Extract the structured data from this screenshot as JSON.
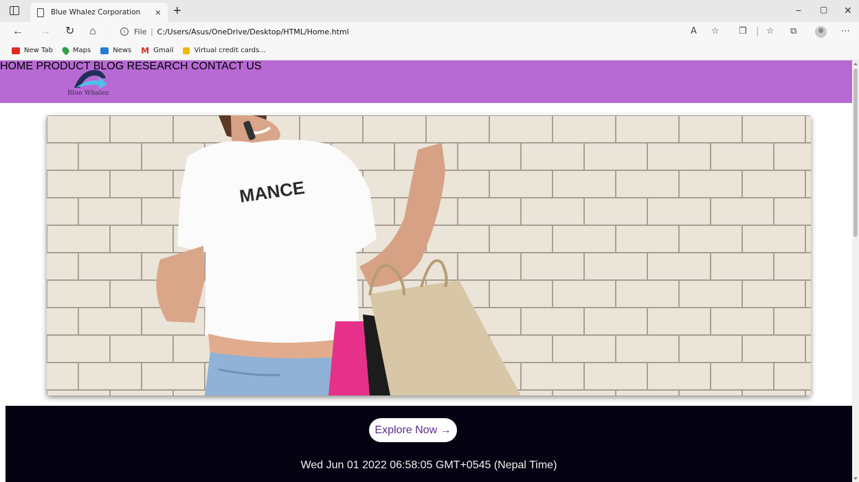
{
  "browser": {
    "tab_title": "Blue Whalez Corporation",
    "address_scheme": "File",
    "address_url": "C:/Users/Asus/OneDrive/Desktop/HTML/Home.html",
    "bookmarks": [
      {
        "label": "New Tab",
        "icon": "youtube-icon",
        "color": "#e02b20"
      },
      {
        "label": "Maps",
        "icon": "maps-pin-icon",
        "color": "#2f9e44"
      },
      {
        "label": "News",
        "icon": "news-icon",
        "color": "#2b7bd6"
      },
      {
        "label": "Gmail",
        "icon": "gmail-icon",
        "color": "#d93025"
      },
      {
        "label": "Virtual credit cards...",
        "icon": "card-icon",
        "color": "#f2b705"
      }
    ]
  },
  "site": {
    "brand_color": "#b76ad3",
    "logo_text": "Blue Whalez",
    "nav": [
      {
        "label": "HOME"
      },
      {
        "label": "PRODUCT"
      },
      {
        "label": "BLOG"
      },
      {
        "label": "RESEARCH"
      },
      {
        "label": "CONTACT US"
      }
    ],
    "hero_image": {
      "subject": "woman-with-shopping-bags",
      "shirt_text": "MANCE"
    },
    "cta_label": "Explore Now →",
    "datetime": "Wed Jun 01 2022 06:58:05 GMT+0545 (Nepal Time)",
    "footer_color": "#050212"
  }
}
